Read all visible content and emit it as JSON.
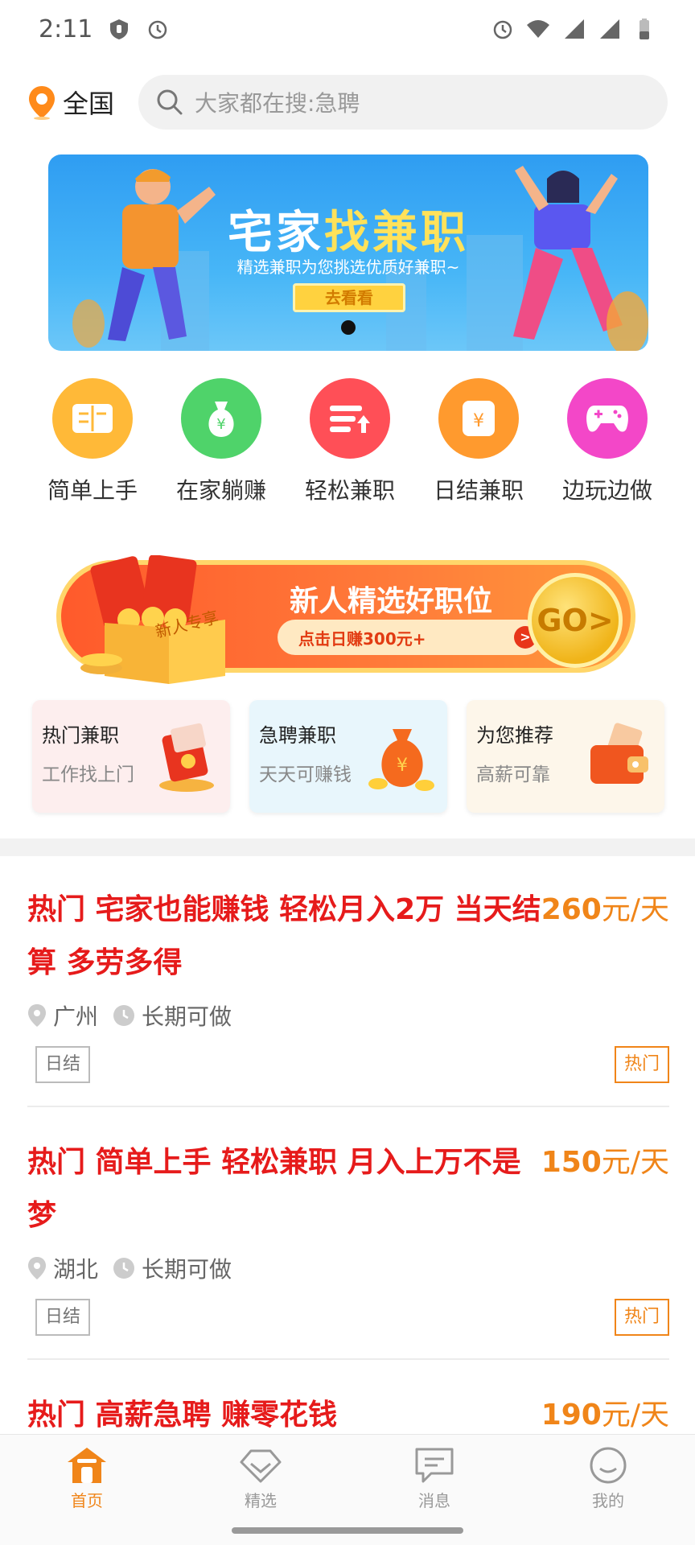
{
  "status_bar": {
    "time": "2:11",
    "icons": [
      "shield-icon",
      "alarm-icon",
      "alarm-icon",
      "wifi-icon",
      "signal-icon",
      "signal-icon",
      "battery-icon"
    ]
  },
  "header": {
    "location_label": "全国",
    "search_placeholder": "大家都在搜:急聘"
  },
  "banner": {
    "title_prefix": "宅家",
    "title_highlight": "找兼职",
    "subtitle": "精选兼职为您挑选优质好兼职~",
    "button_label": "去看看"
  },
  "categories": [
    {
      "label": "简单上手",
      "color": "#ffb938",
      "icon": "book-icon"
    },
    {
      "label": "在家躺赚",
      "color": "#4fd36a",
      "icon": "money-bag-icon"
    },
    {
      "label": "轻松兼职",
      "color": "#ff4f57",
      "icon": "list-up-icon"
    },
    {
      "label": "日结兼职",
      "color": "#ff9a2e",
      "icon": "yen-card-icon"
    },
    {
      "label": "边玩边做",
      "color": "#f347c8",
      "icon": "gamepad-icon"
    }
  ],
  "promo": {
    "box_label": "新人专享",
    "title": "新人精选好职位",
    "button_label": "点击日赚300元+",
    "go_label": "GO>"
  },
  "features": [
    {
      "title": "热门兼职",
      "subtitle": "工作找上门",
      "bg": "#fdeeee",
      "icon": "red-envelope-icon"
    },
    {
      "title": "急聘兼职",
      "subtitle": "天天可赚钱",
      "bg": "#e8f6fc",
      "icon": "money-pouch-icon"
    },
    {
      "title": "为您推荐",
      "subtitle": "高薪可靠",
      "bg": "#fdf6ea",
      "icon": "wallet-icon"
    }
  ],
  "jobs": [
    {
      "title": "热门 宅家也能赚钱 轻松月入2万 当天结算 多劳多得",
      "salary_num": "260",
      "salary_unit": "元/天",
      "location": "广州",
      "duration": "长期可做",
      "tag_left": "日结",
      "tag_right": "热门"
    },
    {
      "title": "热门 简单上手 轻松兼职 月入上万不是梦",
      "salary_num": "150",
      "salary_unit": "元/天",
      "location": "湖北",
      "duration": "长期可做",
      "tag_left": "日结",
      "tag_right": "热门"
    },
    {
      "title": "热门 高薪急聘 赚零花钱",
      "salary_num": "190",
      "salary_unit": "元/天"
    }
  ],
  "bottom_nav": [
    {
      "label": "首页",
      "icon": "home-icon",
      "active": true
    },
    {
      "label": "精选",
      "icon": "diamond-icon",
      "active": false
    },
    {
      "label": "消息",
      "icon": "message-icon",
      "active": false
    },
    {
      "label": "我的",
      "icon": "smile-icon",
      "active": false
    }
  ],
  "colors": {
    "accent": "#f08519",
    "job_title": "#e61b1b"
  }
}
